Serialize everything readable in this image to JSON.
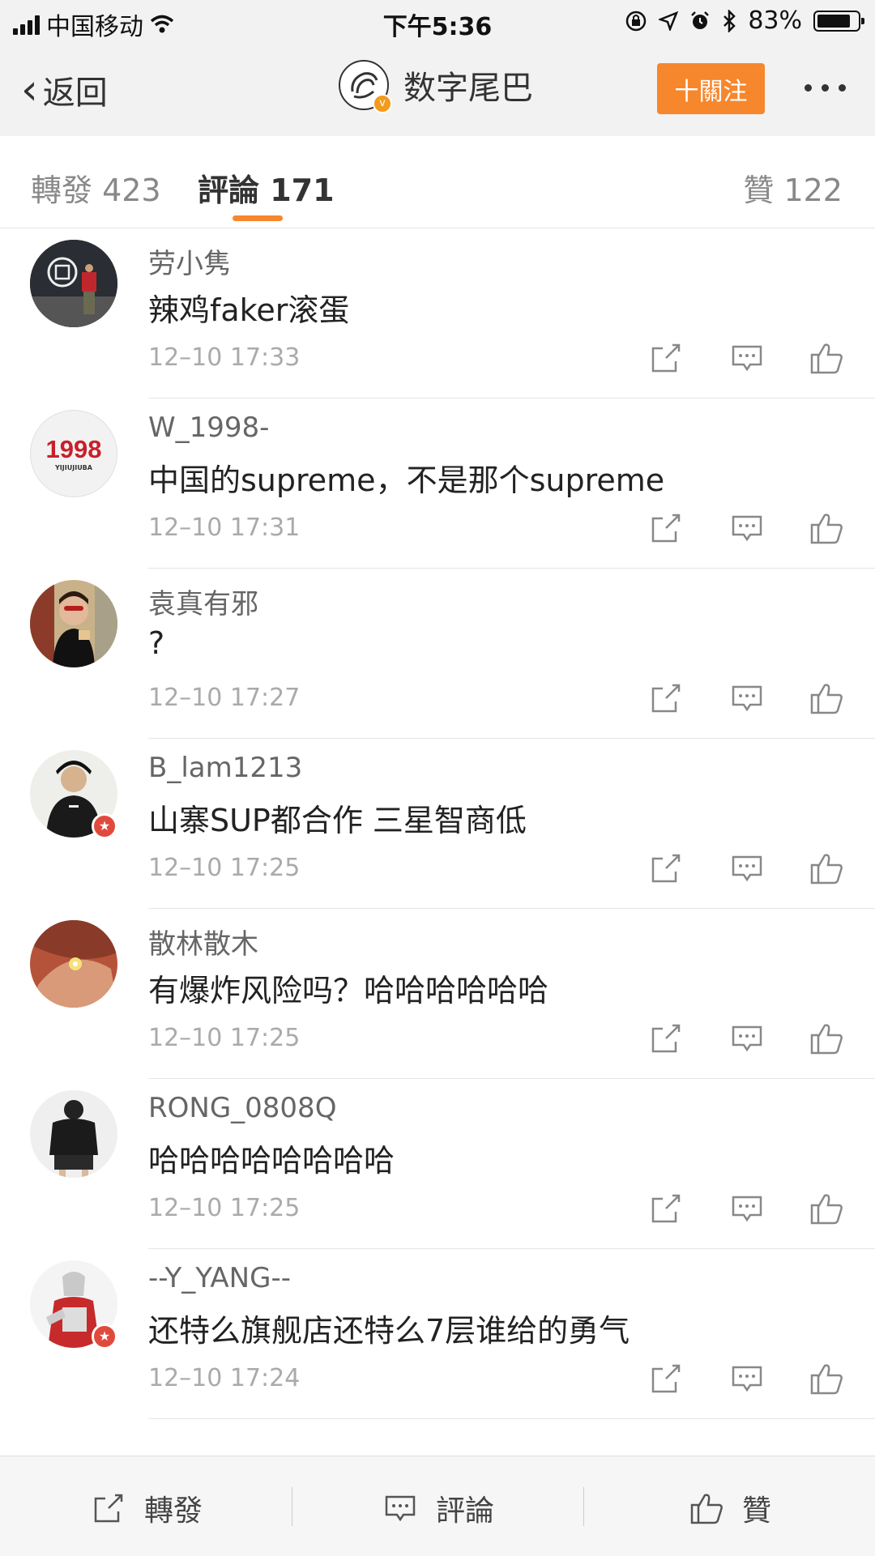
{
  "status_bar": {
    "carrier": "中国移动",
    "time": "下午5:36",
    "battery": "83%",
    "battery_level": 0.83
  },
  "nav": {
    "back_label": "返回",
    "title": "数字尾巴",
    "follow_label": "十關注"
  },
  "tabs": [
    {
      "label": "轉發 423"
    },
    {
      "label": "評論 171"
    },
    {
      "label": "贊 122"
    }
  ],
  "comments": [
    {
      "user": "劳小隽",
      "text": "辣鸡faker滚蛋",
      "time": "12–10 17:33"
    },
    {
      "user": "W_1998-",
      "text": "中国的supreme，不是那个supreme",
      "time": "12–10 17:31",
      "avatar_text": "1998",
      "avatar_sub": "YIJIUJIUBA"
    },
    {
      "user": "袁真有邪",
      "text": "?",
      "time": "12–10 17:27"
    },
    {
      "user": "B_lam1213",
      "text": "山寨SUP都合作 三星智商低",
      "time": "12–10 17:25"
    },
    {
      "user": "散林散木",
      "text": "有爆炸风险吗？哈哈哈哈哈哈",
      "time": "12–10 17:25"
    },
    {
      "user": "RONG_0808Q",
      "text": "哈哈哈哈哈哈哈哈",
      "time": "12–10 17:25"
    },
    {
      "user": "--Y_YANG--",
      "text": "还特么旗舰店还特么7层谁给的勇气",
      "time": "12–10 17:24"
    }
  ],
  "bottom_bar": {
    "repost_label": "轉發",
    "comment_label": "評論",
    "like_label": "贊"
  },
  "colors": {
    "accent": "#f6872d",
    "verified": "#f49a1c",
    "star_badge": "#e04a3d"
  }
}
